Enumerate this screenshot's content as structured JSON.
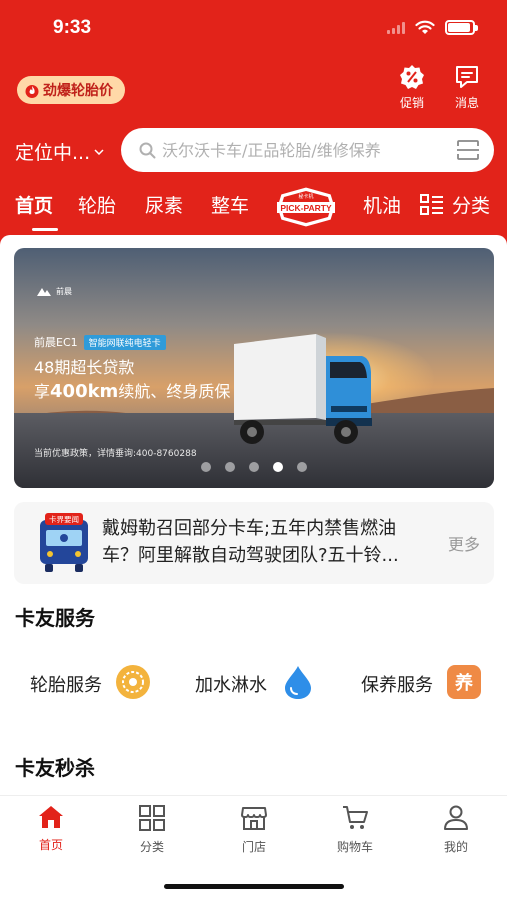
{
  "status_bar": {
    "time": "9:33",
    "battery_level": 0.9
  },
  "header": {
    "promo_label": "劲爆轮胎价",
    "actions": [
      {
        "label": "促销",
        "icon": "discount-badge-icon"
      },
      {
        "label": "消息",
        "icon": "message-icon"
      }
    ],
    "location_label": "定位中...",
    "search_placeholder": "沃尔沃卡车/正品轮胎/维修保养"
  },
  "nav": {
    "tabs": [
      {
        "label": "首页",
        "active": true
      },
      {
        "label": "轮胎"
      },
      {
        "label": "尿素"
      },
      {
        "label": "整车"
      },
      {
        "label": "机油"
      },
      {
        "label": "分类"
      }
    ],
    "pick_badge_text": "PICK-PARTY",
    "pick_badge_top": "秘卡机"
  },
  "banner": {
    "logo_text": "前晨",
    "model": "前晨EC1",
    "tag": "智能网联纯电轻卡",
    "line1": "48期超长贷款",
    "line2_prefix": "享",
    "line2_bold": "400km",
    "line2_suffix": "续航、终身质保",
    "note": "当前优惠政策，详情垂询:400-8760288",
    "slide_count": 5,
    "active_slide": 4
  },
  "news": {
    "badge": "卡界要闻",
    "text": "戴姆勒召回部分卡车;五年内禁售燃油车？阿里解散自动驾驶团队?五十铃...",
    "more": "更多"
  },
  "services": {
    "title": "卡友服务",
    "items": [
      {
        "label": "轮胎服务",
        "icon": "tire-icon",
        "bg": "#fdf5e8"
      },
      {
        "label": "加水淋水",
        "icon": "water-drop-icon",
        "bg": "#eef4fc"
      },
      {
        "label": "保养服务",
        "icon": "maintenance-icon",
        "icon_text": "养",
        "bg": "#fdf0ea"
      }
    ]
  },
  "flash_sale": {
    "title": "卡友秒杀"
  },
  "tabbar": {
    "items": [
      {
        "label": "首页",
        "icon": "home-icon",
        "active": true
      },
      {
        "label": "分类",
        "icon": "category-icon"
      },
      {
        "label": "门店",
        "icon": "store-icon"
      },
      {
        "label": "购物车",
        "icon": "cart-icon"
      },
      {
        "label": "我的",
        "icon": "profile-icon"
      }
    ]
  },
  "colors": {
    "brand_red": "#e2231a",
    "promo_pill": "#ffd9a8",
    "muted_text": "#999999"
  }
}
